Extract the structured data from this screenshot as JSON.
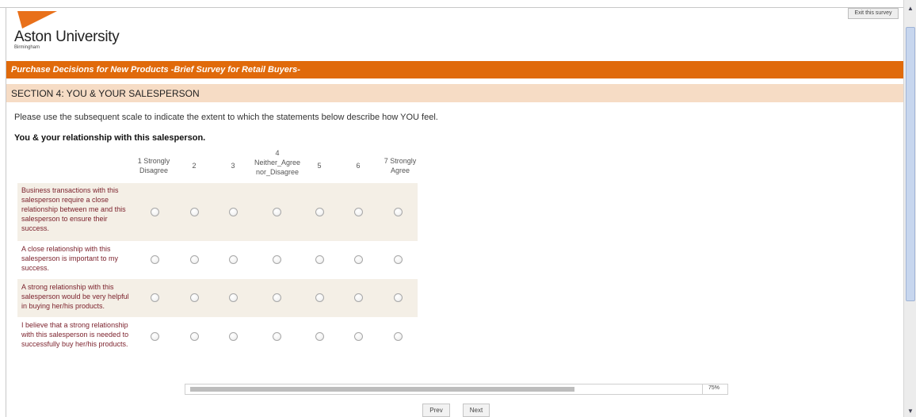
{
  "header": {
    "university": "Aston University",
    "city": "Birmingham",
    "exit_label": "Exit this survey"
  },
  "survey_title": "Purchase Decisions for New Products -Brief Survey for Retail Buyers-",
  "section_title": "SECTION 4: YOU & YOUR SALESPERSON",
  "instructions": "Please use the subsequent scale to indicate the extent to which the statements below describe how YOU feel.",
  "question_heading": "You & your relationship with this salesperson.",
  "scale": [
    {
      "line1": "1 Strongly",
      "line2": "Disagree",
      "line3": ""
    },
    {
      "line1": "2",
      "line2": "",
      "line3": ""
    },
    {
      "line1": "3",
      "line2": "",
      "line3": ""
    },
    {
      "line1": "4",
      "line2": "Neither_Agree",
      "line3": "nor_Disagree"
    },
    {
      "line1": "5",
      "line2": "",
      "line3": ""
    },
    {
      "line1": "6",
      "line2": "",
      "line3": ""
    },
    {
      "line1": "7 Strongly",
      "line2": "Agree",
      "line3": ""
    }
  ],
  "statements": [
    {
      "lines": [
        "Business transactions with this",
        "salesperson require a close",
        "relationship between me and this",
        "salesperson to ensure their",
        "success."
      ],
      "selected": null
    },
    {
      "lines": [
        "A close relationship with this",
        "salesperson is important to my",
        "success."
      ],
      "selected": null
    },
    {
      "lines": [
        "A strong relationship with this",
        "salesperson would be very helpful",
        "in buying her/his products."
      ],
      "selected": null
    },
    {
      "lines": [
        "I believe that a strong relationship",
        "with this salesperson is needed to",
        "successfully buy her/his products."
      ],
      "selected": null
    }
  ],
  "progress": {
    "fraction": 0.75,
    "label": "75%"
  },
  "nav": {
    "prev_label": "Prev",
    "next_label": "Next"
  },
  "colors": {
    "brand_orange": "#e06a0b",
    "section_bg": "#f6dcc5",
    "row_shade": "#f4efe6",
    "statement_text": "#7a1f2a"
  }
}
